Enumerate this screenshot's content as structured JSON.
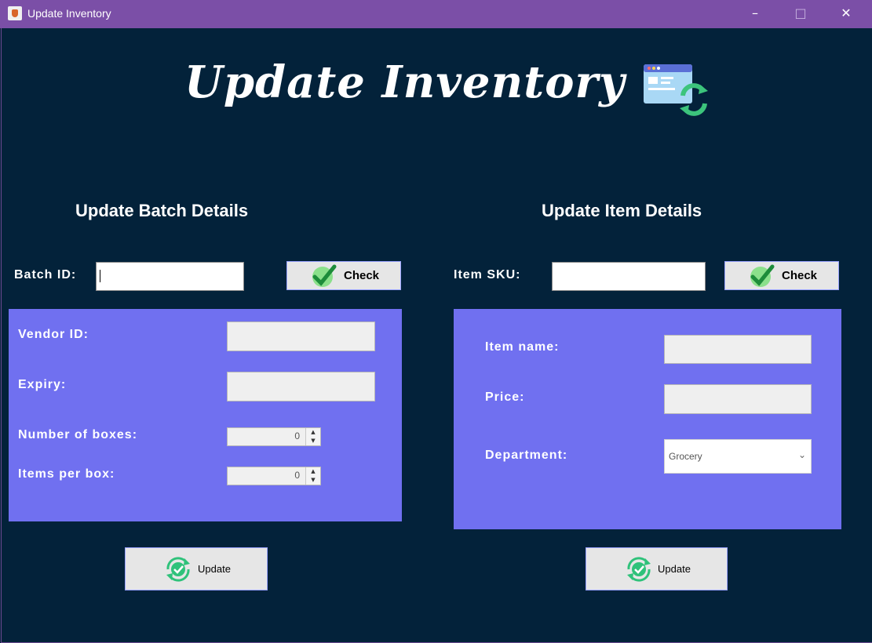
{
  "window": {
    "title": "Update Inventory",
    "minimize": "–",
    "maximize": "□",
    "close": "✕"
  },
  "header": {
    "title": "Update Inventory"
  },
  "batch": {
    "section_title": "Update Batch Details",
    "batch_id_label": "Batch ID:",
    "batch_id_value": "",
    "check_label": "Check",
    "vendor_label": "Vendor ID:",
    "expiry_label": "Expiry:",
    "boxes_label": "Number of boxes:",
    "boxes_value": "0",
    "items_per_box_label": "Items per box:",
    "items_per_box_value": "0",
    "update_label": "Update"
  },
  "item": {
    "section_title": "Update Item Details",
    "sku_label": "Item SKU:",
    "sku_value": "",
    "check_label": "Check",
    "name_label": "Item name:",
    "price_label": "Price:",
    "department_label": "Department:",
    "department_value": "Grocery",
    "update_label": "Update"
  },
  "colors": {
    "titlebar": "#7b4fa7",
    "background": "#03223a",
    "panel": "#7070f0",
    "check_green": "#1db54a"
  }
}
